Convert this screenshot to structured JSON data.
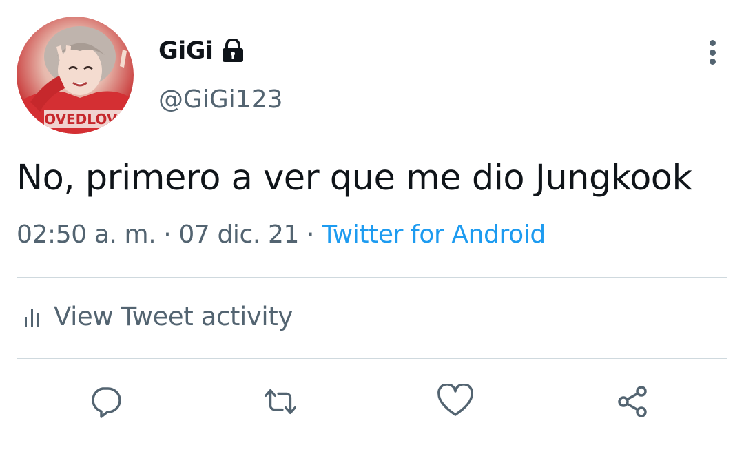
{
  "tweet": {
    "author": {
      "display_name": "GiGi",
      "handle": "@GiGi123",
      "protected_icon": "lock-icon",
      "avatar_text": "OVEDLOVE"
    },
    "text": "No, primero a ver que me dio Jungkook",
    "time": "02:50 a. m.",
    "separator": "·",
    "date": "07 dic. 21",
    "source": "Twitter for Android"
  },
  "activity": {
    "label": "View Tweet activity",
    "icon": "bar-chart-icon"
  },
  "actions": {
    "reply_icon": "reply-icon",
    "retweet_icon": "retweet-icon",
    "like_icon": "heart-icon",
    "share_icon": "share-icon"
  },
  "colors": {
    "text_primary": "#0f1419",
    "text_secondary": "#536471",
    "link": "#1d9bf0",
    "divider": "#cfd9de"
  }
}
